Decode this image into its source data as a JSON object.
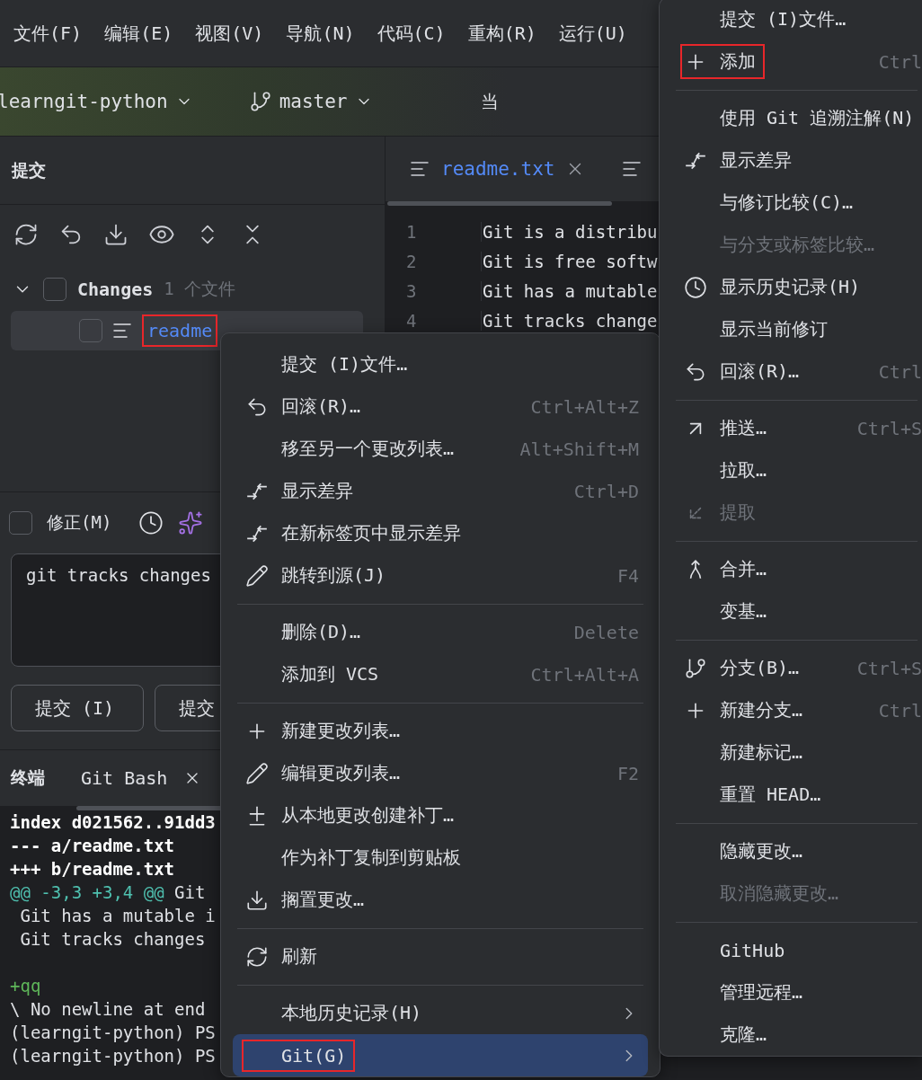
{
  "menu_bar": [
    "文件(F)",
    "编辑(E)",
    "视图(V)",
    "导航(N)",
    "代码(C)",
    "重构(R)",
    "运行(U)"
  ],
  "toolbar": {
    "project": "learngit-python",
    "branch": "master",
    "cut_label": "当"
  },
  "commit_panel": {
    "title": "提交",
    "tree": [
      {
        "label": "Changes",
        "count": "1 个文件",
        "expanded": true,
        "checked": false,
        "children": [
          {
            "label": "readme",
            "checked": false,
            "selected": true,
            "highlighted": true
          }
        ]
      }
    ],
    "amend": {
      "label": "修正(M)",
      "checked": false
    },
    "message": "git tracks changes",
    "buttons": [
      "提交 (I)",
      "提交"
    ]
  },
  "terminal": {
    "title": "终端",
    "tab": "Git Bash",
    "lines": [
      {
        "kind": "meta",
        "text": "index d021562..91dd3"
      },
      {
        "kind": "meta",
        "text": "--- a/readme.txt"
      },
      {
        "kind": "meta",
        "text": "+++ b/readme.txt"
      },
      {
        "kind": "hunk",
        "range": "@@ -3,3 +3,4 @@",
        "text": " Git"
      },
      {
        "kind": "context",
        "text": " Git has a mutable i"
      },
      {
        "kind": "context",
        "text": " Git tracks changes"
      },
      {
        "kind": "blank"
      },
      {
        "kind": "added",
        "text": "+qq"
      },
      {
        "kind": "context",
        "text": "\\ No newline at end"
      },
      {
        "kind": "context",
        "text": "(learngit-python) PS"
      },
      {
        "kind": "context",
        "text": "(learngit-python) PS"
      }
    ]
  },
  "editor": {
    "tab": "readme.txt",
    "lines": [
      {
        "number": "1",
        "text": "Git is a distribu"
      },
      {
        "number": "2",
        "text": "Git is free softw"
      },
      {
        "number": "3",
        "text": "Git has a mutable"
      },
      {
        "number": "4",
        "text": "Git tracks change"
      }
    ]
  },
  "context_menu": {
    "sections": [
      [
        {
          "label": "提交 (I)文件…",
          "selected": false,
          "highlighted": false,
          "submenu": false
        },
        {
          "label": "回滚(R)…",
          "kind": "undo",
          "shortcut": "Ctrl+Alt+Z",
          "selected": false,
          "highlighted": false,
          "submenu": false
        },
        {
          "label": "移至另一个更改列表…",
          "shortcut": "Alt+Shift+M",
          "selected": false,
          "highlighted": false,
          "submenu": false
        },
        {
          "label": "显示差异",
          "kind": "diff",
          "shortcut": "Ctrl+D",
          "selected": false,
          "highlighted": false,
          "submenu": false
        },
        {
          "label": "在新标签页中显示差异",
          "kind": "diff",
          "selected": false,
          "highlighted": false,
          "submenu": false
        },
        {
          "label": "跳转到源(J)",
          "kind": "pencil",
          "shortcut": "F4",
          "selected": false,
          "highlighted": false,
          "submenu": false
        }
      ],
      [
        {
          "label": "删除(D)…",
          "shortcut": "Delete",
          "selected": false,
          "highlighted": false,
          "submenu": false
        },
        {
          "label": "添加到 VCS",
          "shortcut": "Ctrl+Alt+A",
          "selected": false,
          "highlighted": false,
          "submenu": false
        }
      ],
      [
        {
          "label": "新建更改列表…",
          "kind": "plus",
          "selected": false,
          "highlighted": false,
          "submenu": false
        },
        {
          "label": "编辑更改列表…",
          "kind": "pencil",
          "shortcut": "F2",
          "selected": false,
          "highlighted": false,
          "submenu": false
        },
        {
          "label": "从本地更改创建补丁…",
          "kind": "plusminus",
          "selected": false,
          "highlighted": false,
          "submenu": false
        },
        {
          "label": "作为补丁复制到剪贴板",
          "selected": false,
          "highlighted": false,
          "submenu": false
        },
        {
          "label": "搁置更改…",
          "kind": "shelve",
          "selected": false,
          "highlighted": false,
          "submenu": false
        }
      ],
      [
        {
          "label": "刷新",
          "kind": "refresh",
          "selected": false,
          "highlighted": false,
          "submenu": false
        }
      ],
      [
        {
          "label": "本地历史记录(H)",
          "selected": false,
          "highlighted": false,
          "submenu": true
        },
        {
          "label": "Git(G)",
          "selected": true,
          "highlighted": true,
          "submenu": true
        }
      ]
    ]
  },
  "git_submenu": {
    "sections": [
      [
        {
          "label": "提交 (I)文件…",
          "disabled": false,
          "highlighted": false
        },
        {
          "label": "添加",
          "kind": "plus",
          "shortcut": "Ctrl",
          "disabled": false,
          "highlighted": true
        }
      ],
      [
        {
          "label": "使用 Git 追溯注解(N)",
          "disabled": false,
          "highlighted": false
        },
        {
          "label": "显示差异",
          "kind": "diff",
          "disabled": false,
          "highlighted": false
        },
        {
          "label": "与修订比较(C)…",
          "disabled": false,
          "highlighted": false
        },
        {
          "label": "与分支或标签比较…",
          "disabled": true,
          "highlighted": false
        },
        {
          "label": "显示历史记录(H)",
          "kind": "clock",
          "disabled": false,
          "highlighted": false
        },
        {
          "label": "显示当前修订",
          "disabled": false,
          "highlighted": false
        },
        {
          "label": "回滚(R)…",
          "kind": "undo",
          "shortcut": "Ctrl",
          "disabled": false,
          "highlighted": false
        }
      ],
      [
        {
          "label": "推送…",
          "kind": "push",
          "shortcut": "Ctrl+S",
          "disabled": false,
          "highlighted": false
        },
        {
          "label": "拉取…",
          "disabled": false,
          "highlighted": false
        },
        {
          "label": "提取",
          "kind": "fetch",
          "disabled": true,
          "highlighted": false
        }
      ],
      [
        {
          "label": "合并…",
          "kind": "merge",
          "disabled": false,
          "highlighted": false
        },
        {
          "label": "变基…",
          "disabled": false,
          "highlighted": false
        }
      ],
      [
        {
          "label": "分支(B)…",
          "kind": "branch",
          "shortcut": "Ctrl+S",
          "disabled": false,
          "highlighted": false
        },
        {
          "label": "新建分支…",
          "kind": "plus",
          "shortcut": "Ctrl",
          "disabled": false,
          "highlighted": false
        },
        {
          "label": "新建标记…",
          "disabled": false,
          "highlighted": false
        },
        {
          "label": "重置 HEAD…",
          "disabled": false,
          "highlighted": false
        }
      ],
      [
        {
          "label": "隐藏更改…",
          "disabled": false,
          "highlighted": false
        },
        {
          "label": "取消隐藏更改…",
          "disabled": true,
          "highlighted": false
        }
      ],
      [
        {
          "label": "GitHub",
          "disabled": false,
          "highlighted": false
        },
        {
          "label": "管理远程…",
          "disabled": false,
          "highlighted": false
        },
        {
          "label": "克隆…",
          "disabled": false,
          "highlighted": false
        }
      ]
    ]
  }
}
